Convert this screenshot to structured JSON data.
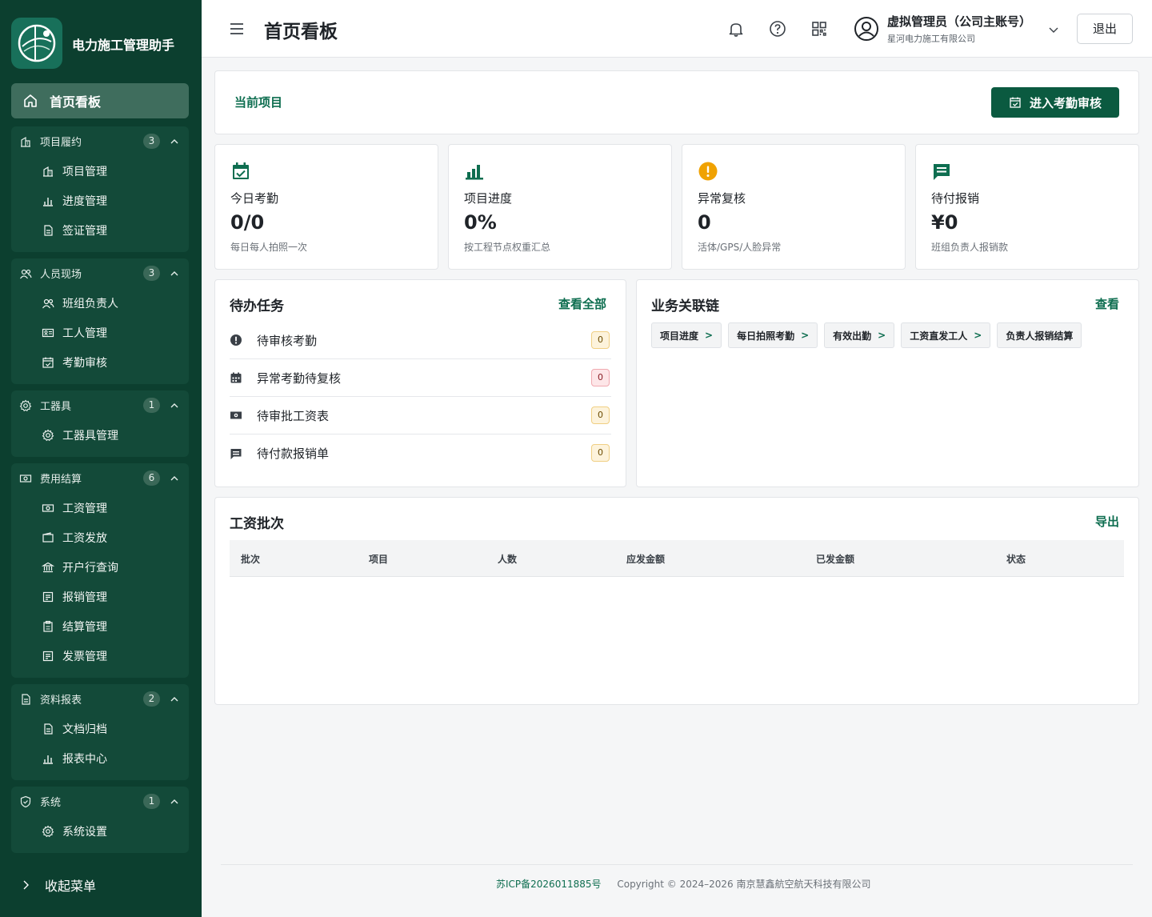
{
  "brand": {
    "name": "电力施工管理助手"
  },
  "sidebar": {
    "home": "首页看板",
    "groups": [
      {
        "label": "项目履约",
        "count": "3",
        "items": [
          {
            "label": "项目管理"
          },
          {
            "label": "进度管理"
          },
          {
            "label": "签证管理"
          }
        ]
      },
      {
        "label": "人员现场",
        "count": "3",
        "items": [
          {
            "label": "班组负责人"
          },
          {
            "label": "工人管理"
          },
          {
            "label": "考勤审核"
          }
        ]
      },
      {
        "label": "工器具",
        "count": "1",
        "items": [
          {
            "label": "工器具管理"
          }
        ]
      },
      {
        "label": "费用结算",
        "count": "6",
        "items": [
          {
            "label": "工资管理"
          },
          {
            "label": "工资发放"
          },
          {
            "label": "开户行查询"
          },
          {
            "label": "报销管理"
          },
          {
            "label": "结算管理"
          },
          {
            "label": "发票管理"
          }
        ]
      },
      {
        "label": "资料报表",
        "count": "2",
        "items": [
          {
            "label": "文档归档"
          },
          {
            "label": "报表中心"
          }
        ]
      },
      {
        "label": "系统",
        "count": "1",
        "items": [
          {
            "label": "系统设置"
          }
        ]
      }
    ],
    "collapse": "收起菜单"
  },
  "header": {
    "title": "首页看板",
    "user_name": "虚拟管理员（公司主账号）",
    "company": "星河电力施工有限公司",
    "logout": "退出"
  },
  "current_project": {
    "label": "当前项目",
    "button": "进入考勤审核"
  },
  "stats": [
    {
      "label": "今日考勤",
      "value": "0/0",
      "desc": "每日每人拍照一次",
      "icon": "calendar-check-icon"
    },
    {
      "label": "项目进度",
      "value": "0%",
      "desc": "按工程节点权重汇总",
      "icon": "bar-chart-icon"
    },
    {
      "label": "异常复核",
      "value": "0",
      "desc": "活体/GPS/人脸异常",
      "icon": "warning-icon"
    },
    {
      "label": "待付报销",
      "value": "¥0",
      "desc": "班组负责人报销款",
      "icon": "receipt-icon"
    }
  ],
  "todo": {
    "title": "待办任务",
    "view_all": "查看全部",
    "items": [
      {
        "label": "待审核考勤",
        "count": "0"
      },
      {
        "label": "异常考勤待复核",
        "count": "0"
      },
      {
        "label": "待审批工资表",
        "count": "0"
      },
      {
        "label": "待付款报销单",
        "count": "0"
      }
    ]
  },
  "chain": {
    "title": "业务关联链",
    "view": "查看",
    "items": [
      {
        "label": "项目进度"
      },
      {
        "label": "每日拍照考勤"
      },
      {
        "label": "有效出勤"
      },
      {
        "label": "工资直发工人"
      },
      {
        "label": "负责人报销结算"
      }
    ],
    "arrow": ">"
  },
  "payroll": {
    "title": "工资批次",
    "export": "导出",
    "columns": [
      "批次",
      "项目",
      "人数",
      "应发金额",
      "已发金额",
      "状态"
    ]
  },
  "footer": {
    "icp": "苏ICP备2026011885号",
    "copyright": "Copyright © 2024–2026 南京慧鑫航空航天科技有限公司"
  },
  "colors": {
    "sidebar": "#0c3f2f",
    "primary": "#0b5a40",
    "accent_text": "#0e6e50",
    "warning": "#f0a202"
  }
}
